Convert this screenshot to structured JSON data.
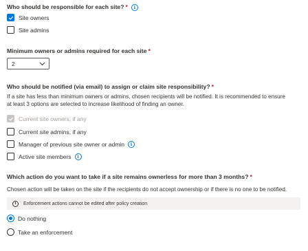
{
  "q1": {
    "title": "Who should be responsible for each site?",
    "required": "*",
    "options": [
      {
        "label": "Site owners",
        "checked": true
      },
      {
        "label": "Site admins",
        "checked": false
      }
    ]
  },
  "q2": {
    "title": "Minimum owners or admins required for each site",
    "required": "*",
    "selected_value": "2"
  },
  "q3": {
    "title": "Who should be notified (via email) to assign or claim site responsibility?",
    "required": "*",
    "description_line1": "If a site has less than minimum owners or admins, chosen recipients will be notified. It is recommended to ensure",
    "description_line2": "at least 3 options are selected to increase likelihood of finding an owner.",
    "options": [
      {
        "label": "Current site owners, if any",
        "checked": true,
        "disabled": true
      },
      {
        "label": "Current site admins, if any",
        "checked": false
      },
      {
        "label": "Manager of previous site owner or admin",
        "checked": false
      },
      {
        "label": "Active site members",
        "checked": false
      }
    ]
  },
  "q4": {
    "title": "Which action do you want to take if a site remains ownerless for more than 3 months?",
    "required": "*",
    "description": "Chosen action will be taken on the site if the recipients do not accept ownership or if there is no one to be notified.",
    "banner": "Enforcement actions cannot be edited after policy creation",
    "options": [
      {
        "label": "Do nothing",
        "selected": true
      },
      {
        "label": "Take an enforcement",
        "selected": false
      }
    ]
  },
  "colors": {
    "accent": "#0078d4",
    "required": "#a4262c",
    "banner_bg": "#f3f2f1",
    "disabled": "#c8c6c4"
  },
  "icons": {
    "info": "info-icon",
    "checkmark": "checkmark-icon",
    "chevron": "chevron-down-icon"
  }
}
